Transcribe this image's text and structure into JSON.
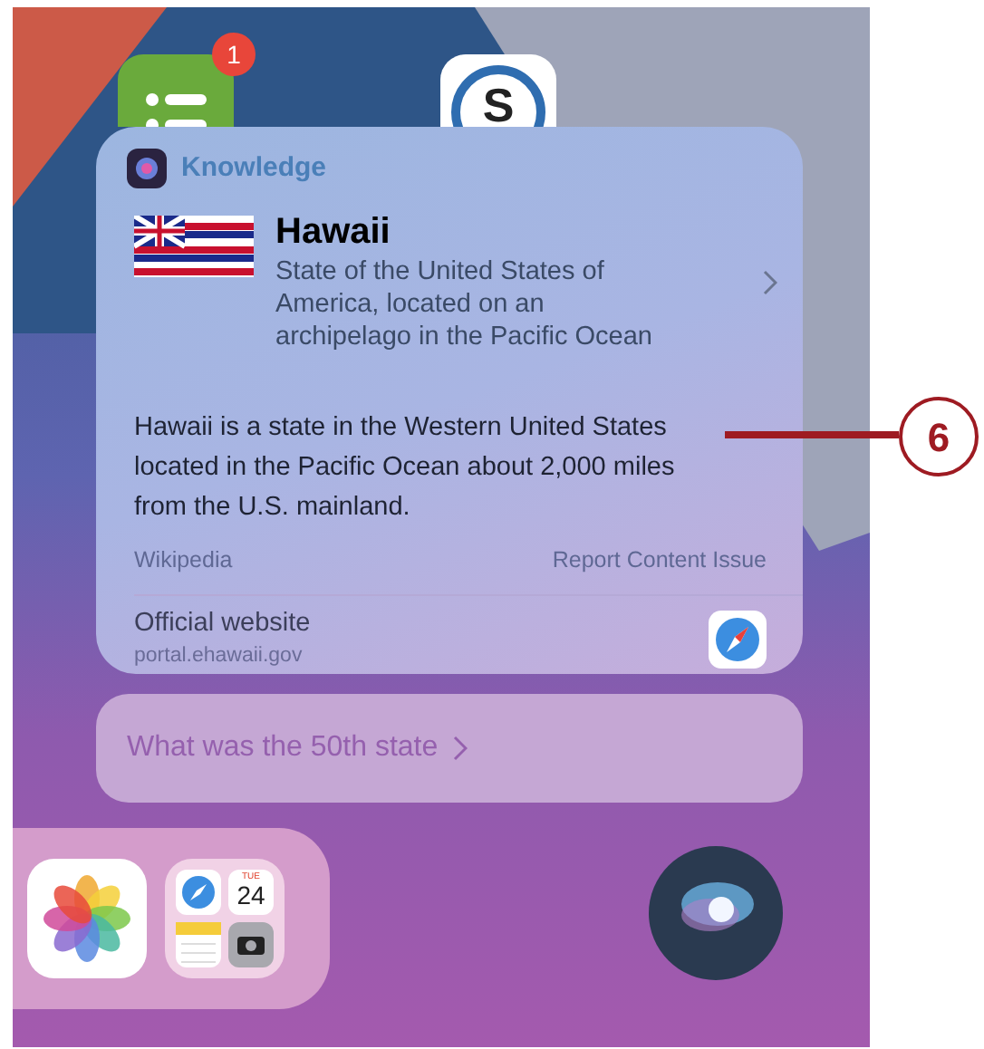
{
  "home_icons": [
    {
      "kind": "list",
      "badge": "1"
    },
    {
      "kind": "letter",
      "label": "S"
    }
  ],
  "card": {
    "source": "Knowledge",
    "title": "Hawaii",
    "subtitle": "State of the United States of America, located on an archipelago in the Pacific Ocean",
    "summary": "Hawaii is a state in the Western United States located in the Pacific Ocean about 2,000 miles from the U.S. mainland.",
    "attribution": "Wikipedia",
    "report_link": "Report Content Issue",
    "website": {
      "label": "Official website",
      "url": "portal.ehawaii.gov"
    }
  },
  "suggestion": "What was the 50th state",
  "dock": {
    "calendar": {
      "day": "TUE",
      "date": "24"
    }
  },
  "callout": "6"
}
